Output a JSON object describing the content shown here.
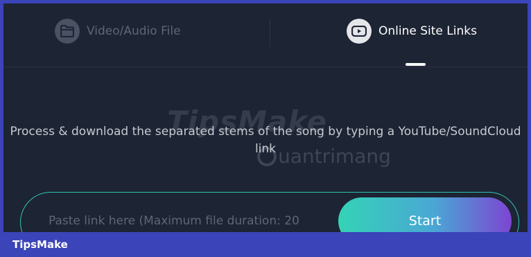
{
  "tabs": [
    {
      "label": "Video/Audio File",
      "icon": "folder-icon",
      "active": false
    },
    {
      "label": "Online Site Links",
      "icon": "youtube-icon",
      "active": true
    }
  ],
  "description": "Process & download the separated stems of the song by typing a YouTube/SoundCloud link",
  "link_input": {
    "placeholder": "Paste link here (Maximum file duration: 20",
    "value": ""
  },
  "start_button": {
    "label": "Start"
  },
  "watermarks": {
    "primary": "TipsMake",
    "secondary": "uantrimang"
  },
  "footer": {
    "brand": "TipsMake"
  },
  "colors": {
    "background": "#1d2433",
    "frame_border": "#3b44b8",
    "accent_teal": "#34d3b6",
    "accent_purple": "#7d45d2"
  }
}
